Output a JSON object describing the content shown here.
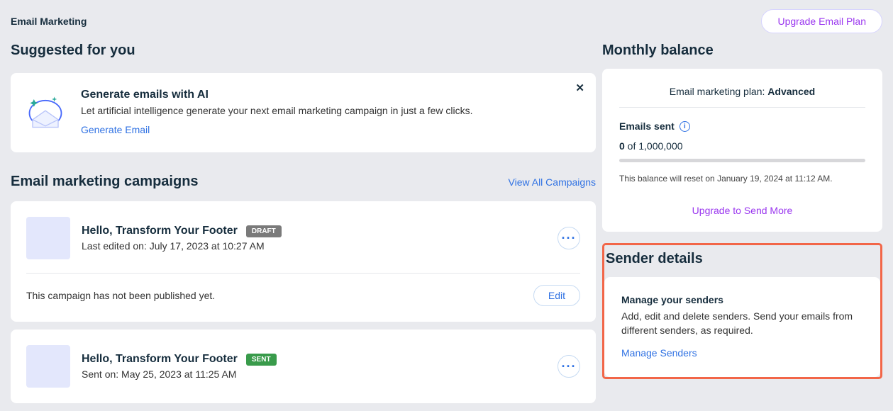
{
  "header": {
    "page_title": "Email Marketing",
    "upgrade_button": "Upgrade Email Plan"
  },
  "suggested": {
    "header": "Suggested for you",
    "item": {
      "title": "Generate emails with AI",
      "desc": "Let artificial intelligence generate your next email marketing campaign in just a few clicks.",
      "link": "Generate Email"
    }
  },
  "campaigns": {
    "header": "Email marketing campaigns",
    "view_all": "View All Campaigns",
    "items": [
      {
        "title": "Hello, Transform Your Footer",
        "badge": "DRAFT",
        "meta": "Last edited on: July 17, 2023 at 10:27 AM",
        "status_note": "This campaign has not been published yet.",
        "edit_label": "Edit"
      },
      {
        "title": "Hello, Transform Your Footer",
        "badge": "SENT",
        "meta": "Sent on: May 25, 2023 at 11:25 AM"
      }
    ]
  },
  "balance": {
    "header": "Monthly balance",
    "plan_prefix": "Email marketing plan: ",
    "plan_name": "Advanced",
    "emails_sent_label": "Emails sent",
    "count_bold": "0",
    "count_rest": " of 1,000,000",
    "reset_note": "This balance will reset on January 19, 2024 at 11:12 AM.",
    "upgrade_more": "Upgrade to Send More"
  },
  "sender": {
    "header": "Sender details",
    "title": "Manage your senders",
    "desc": "Add, edit and delete senders. Send your emails from different senders, as required.",
    "link": "Manage Senders"
  }
}
